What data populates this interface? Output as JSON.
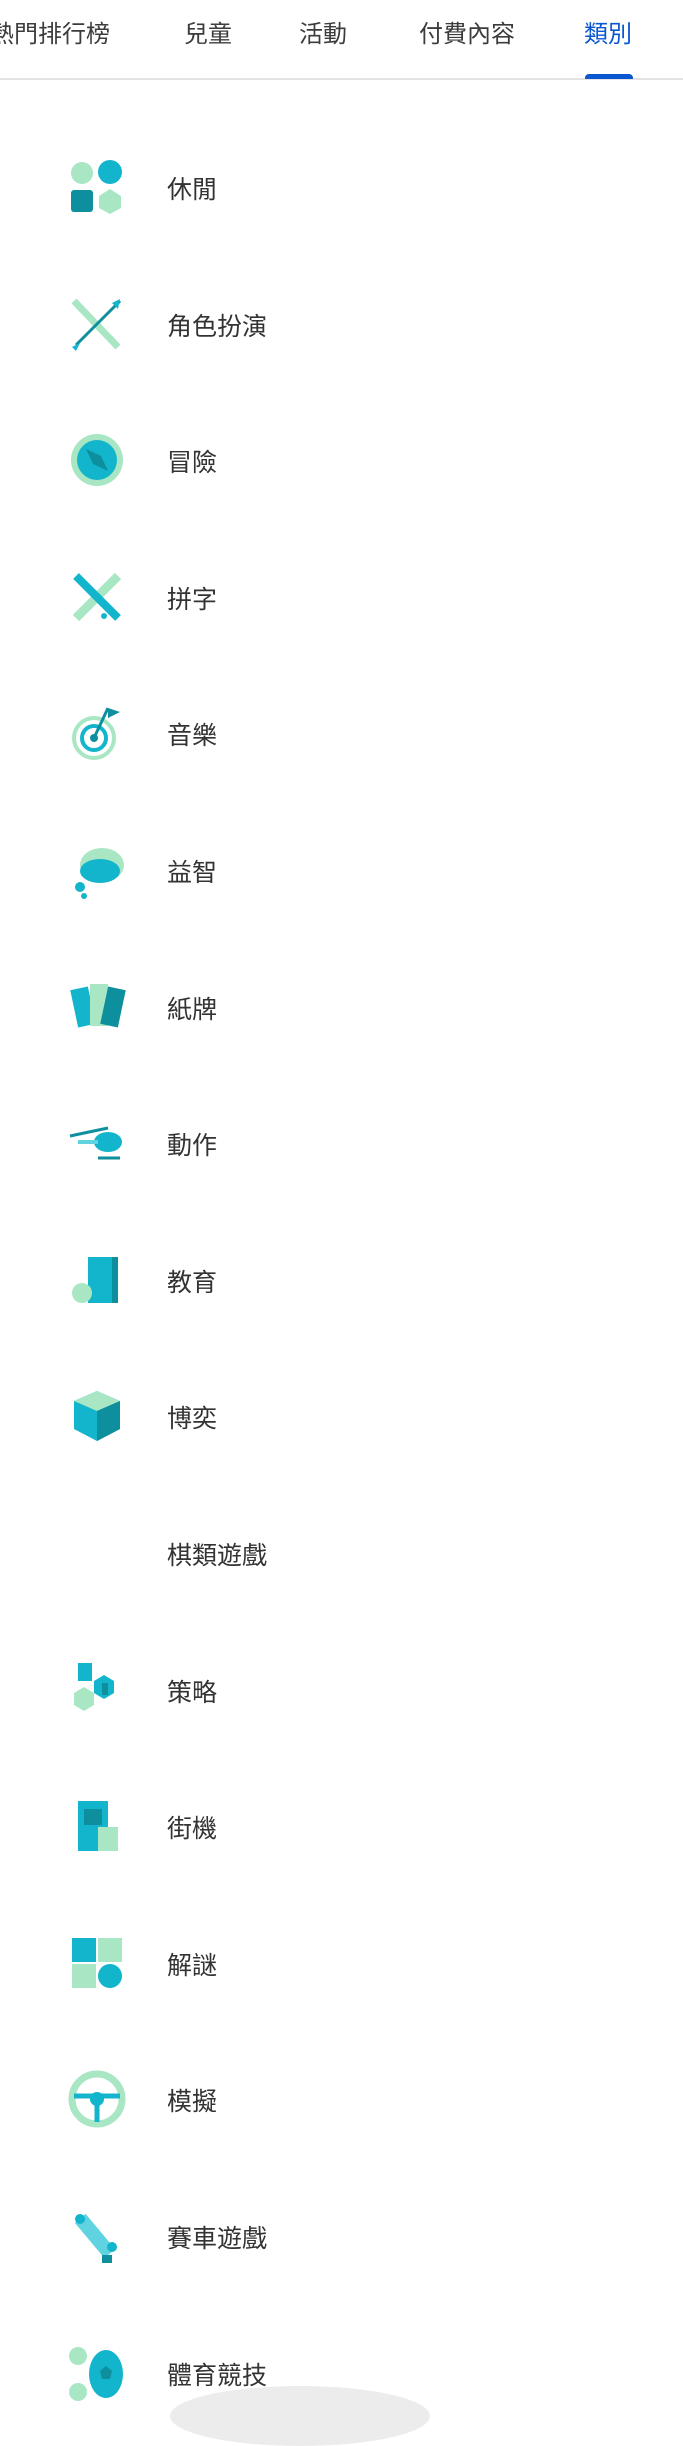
{
  "tabs": [
    {
      "label": "熱門排行榜",
      "active": false
    },
    {
      "label": "兒童",
      "active": false
    },
    {
      "label": "活動",
      "active": false
    },
    {
      "label": "付費內容",
      "active": false
    },
    {
      "label": "類別",
      "active": true
    }
  ],
  "colors": {
    "accent": "#0b57d0",
    "teal": "#12b5cb",
    "dark_teal": "#0e8f9e",
    "mint": "#a8e6c4"
  },
  "categories": [
    {
      "label": "休閒",
      "icon": "casual-icon"
    },
    {
      "label": "角色扮演",
      "icon": "swords-icon"
    },
    {
      "label": "冒險",
      "icon": "compass-icon"
    },
    {
      "label": "拼字",
      "icon": "word-icon"
    },
    {
      "label": "音樂",
      "icon": "music-target-icon"
    },
    {
      "label": "益智",
      "icon": "thought-cloud-icon"
    },
    {
      "label": "紙牌",
      "icon": "cards-icon"
    },
    {
      "label": "動作",
      "icon": "helicopter-icon"
    },
    {
      "label": "教育",
      "icon": "book-apple-icon"
    },
    {
      "label": "博奕",
      "icon": "dice-icon"
    },
    {
      "label": "棋類遊戲",
      "icon": ""
    },
    {
      "label": "策略",
      "icon": "strategy-icon"
    },
    {
      "label": "街機",
      "icon": "arcade-icon"
    },
    {
      "label": "解謎",
      "icon": "puzzle-icon"
    },
    {
      "label": "模擬",
      "icon": "steering-wheel-icon"
    },
    {
      "label": "賽車遊戲",
      "icon": "race-car-icon"
    },
    {
      "label": "體育競技",
      "icon": "sports-balls-icon"
    }
  ]
}
